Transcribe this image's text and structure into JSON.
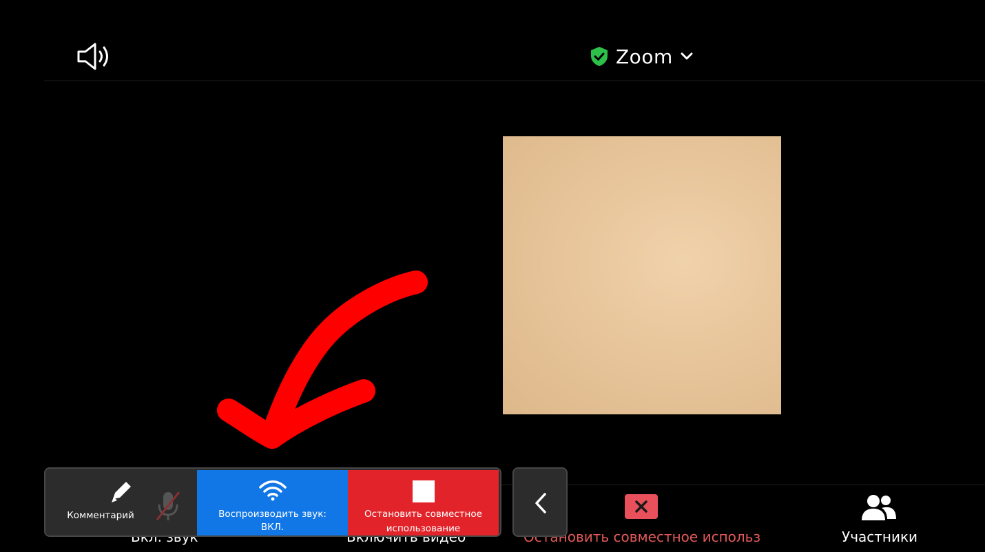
{
  "header": {
    "title": "Zoom",
    "speaker_icon": "speaker-icon",
    "security_icon": "shield-check-icon",
    "security_color": "#2dc14a",
    "dropdown_icon": "chevron-down-icon"
  },
  "share_toolbar": {
    "annotate_label": "Комментарий",
    "audio_label_line1": "Воспроизводить звук:",
    "audio_label_line2": "ВКЛ.",
    "stop_label_line1": "Остановить совместное",
    "stop_label_line2": "использование",
    "colors": {
      "audio": "#1177e6",
      "stop": "#e2242a",
      "panel": "#2c2c2c"
    }
  },
  "bottom_bar": {
    "audio_label": "Вкл. звук",
    "video_label": "Включить видео",
    "stop_share_label": "Остановить совместное использов",
    "participants_label": "Участники",
    "stop_color": "#e45a5a"
  },
  "annotation_arrow_color": "#ff0000"
}
